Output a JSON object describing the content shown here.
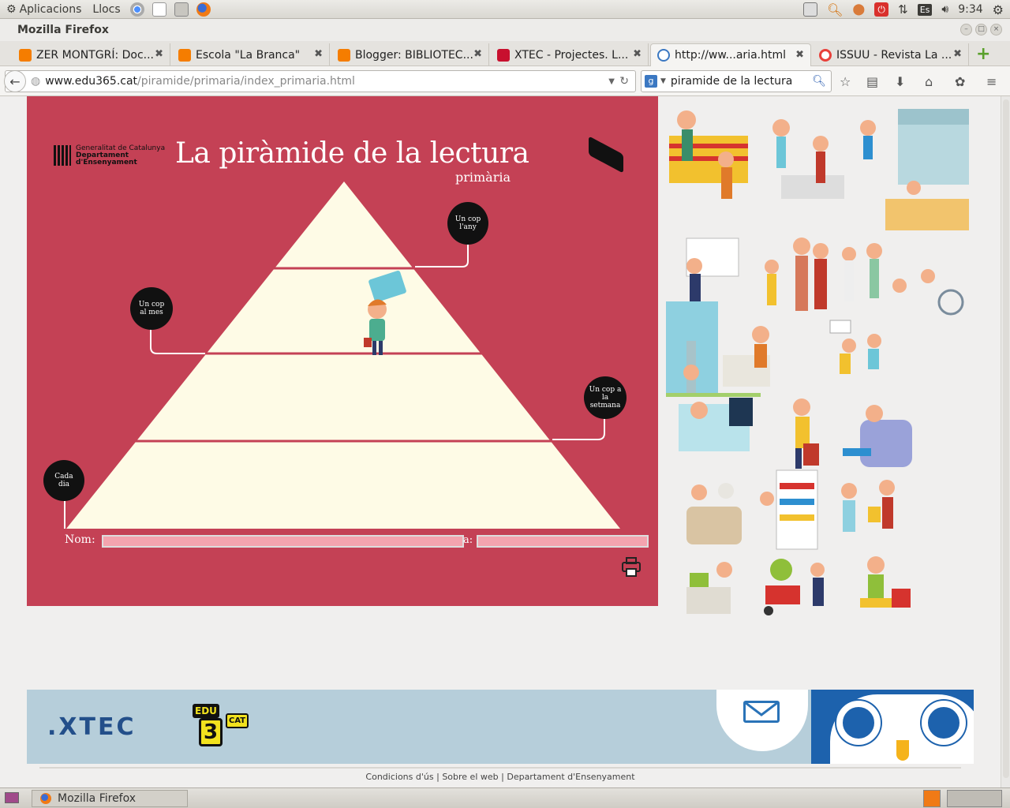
{
  "panel": {
    "apps": "Aplicacions",
    "places": "Llocs",
    "lang": "Es",
    "clock": "9:34"
  },
  "window": {
    "title": "Mozilla Firefox"
  },
  "tabs": [
    {
      "label": "ZER MONTGRÍ: Doc...",
      "color": "#f57d00"
    },
    {
      "label": "Escola \"La Branca\"",
      "color": "#f57d00"
    },
    {
      "label": "Blogger: BIBLIOTEC...",
      "color": "#f57d00"
    },
    {
      "label": "XTEC - Projectes. L...",
      "color": "#c8102e"
    },
    {
      "label": "http://ww...aria.html",
      "color": "#3b78c2"
    },
    {
      "label": "ISSUU - Revista La ...",
      "color": "#e8403a"
    }
  ],
  "nav": {
    "url_host": "www.edu365.cat",
    "url_path": "/piramide/primaria/index_primaria.html",
    "search_value": "piramide de la lectura"
  },
  "app": {
    "title": "La piràmide de la lectura",
    "subtitle": "primària",
    "gencat_line1": "Generalitat de Catalunya",
    "gencat_line2": "Departament",
    "gencat_line3": "d'Ensenyament",
    "badges": {
      "year": "Un cop l'any",
      "month": "Un cop al mes",
      "week": "Un cop a la setmana",
      "day": "Cada dia"
    },
    "name_label": "Nom:",
    "date_label_fragment": "a:",
    "colors": {
      "background": "#c44155",
      "pyramid": "#fefbe6",
      "lines": "#c44155"
    }
  },
  "footer": {
    "xtec": ".XTEC",
    "edu": "EDU",
    "three": "3",
    "cat": "CAT",
    "links": [
      "Condicions d'ús",
      "Sobre el web",
      "Departament d'Ensenyament"
    ],
    "separator": "|"
  },
  "taskbar": {
    "item": "Mozilla Firefox"
  }
}
